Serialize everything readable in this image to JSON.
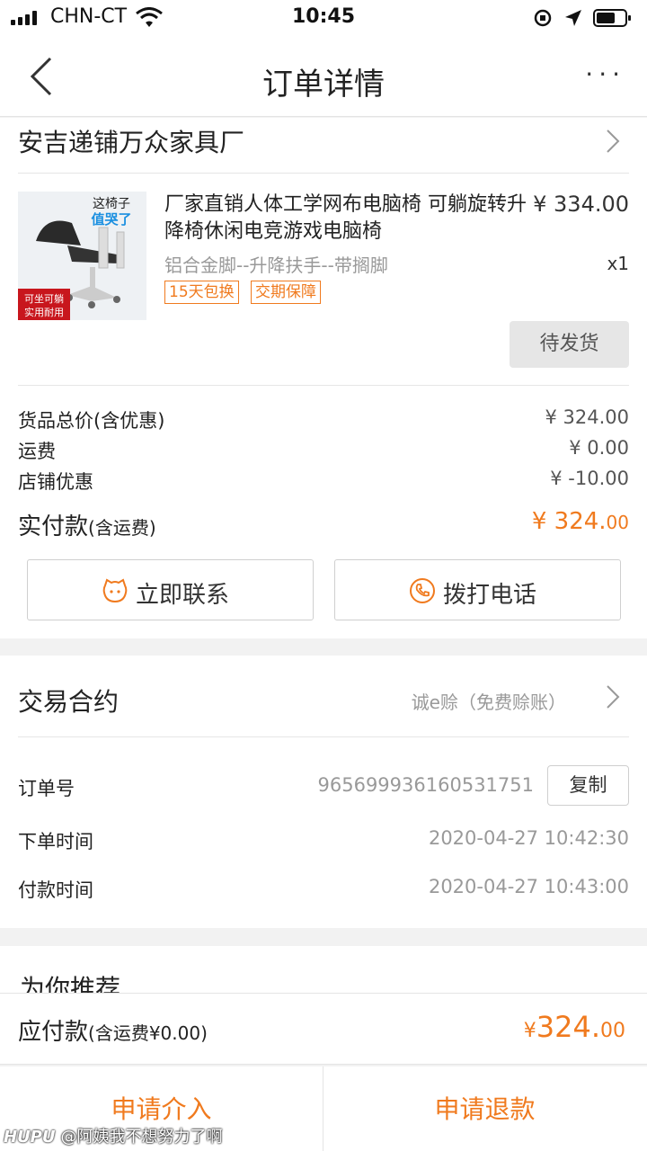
{
  "status_bar": {
    "carrier": "CHN-CT",
    "time": "10:45"
  },
  "header": {
    "title": "订单详情",
    "more": "···"
  },
  "shop": {
    "name": "安吉递铺万众家具厂"
  },
  "product": {
    "title": "厂家直销人体工学网布电脑椅 可躺旋转升降椅休闲电竞游戏电脑椅",
    "price": "¥ 334.00",
    "spec": "铝合金脚--升降扶手--带搁脚",
    "quantity": "x1",
    "tags": [
      "15天包换",
      "交期保障"
    ],
    "status": "待发货",
    "image_text": {
      "top1": "这椅子",
      "top2": "值哭了",
      "bottom1": "可坐可躺",
      "bottom2": "实用耐用"
    }
  },
  "summary": {
    "rows": [
      {
        "label": "货品总价(含优惠)",
        "value": "¥ 324.00"
      },
      {
        "label": "运费",
        "value": "¥ 0.00"
      },
      {
        "label": "店铺优惠",
        "value": "¥ -10.00"
      }
    ],
    "paid_label": "实付款",
    "paid_label_note": "(含运费)",
    "paid_value_main": "¥ 324.",
    "paid_value_cents": "00"
  },
  "actions": {
    "contact": "立即联系",
    "call": "拨打电话"
  },
  "contract": {
    "title": "交易合约",
    "subtitle": "诚e赊（免费赊账）",
    "order_no_label": "订单号",
    "order_no": "965699936160531751",
    "copy": "复制",
    "order_time_label": "下单时间",
    "order_time": "2020-04-27 10:42:30",
    "pay_time_label": "付款时间",
    "pay_time": "2020-04-27 10:43:00"
  },
  "recommend": {
    "title": "为你推荐"
  },
  "pay_bar": {
    "label": "应付款",
    "label_note": "(含运费¥0.00)",
    "currency": "¥",
    "amount_main": "324.",
    "amount_cents": "00"
  },
  "bottom": {
    "apply_intervene": "申请介入",
    "apply_refund": "申请退款"
  },
  "watermark": {
    "brand": "HUPU",
    "text": "@阿姨我不想努力了啊"
  },
  "colors": {
    "accent": "#f07a1e",
    "status_btn_bg": "#e6e6e6"
  }
}
